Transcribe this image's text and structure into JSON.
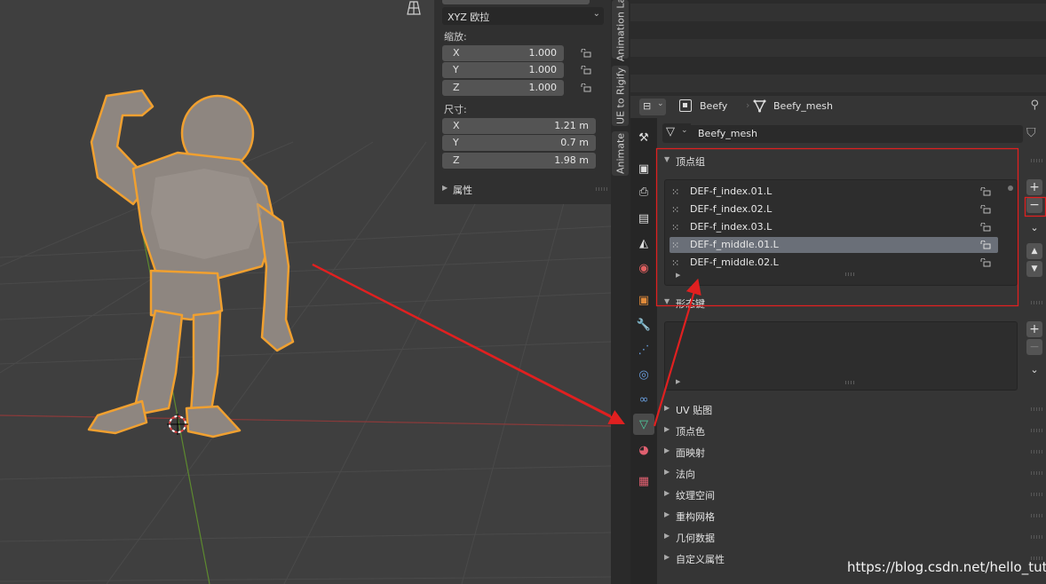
{
  "npanel": {
    "rotation_mode": "XYZ 欧拉",
    "scale_label": "缩放:",
    "scale": [
      {
        "axis": "X",
        "value": "1.000"
      },
      {
        "axis": "Y",
        "value": "1.000"
      },
      {
        "axis": "Z",
        "value": "1.000"
      }
    ],
    "dimensions_label": "尺寸:",
    "dimensions": [
      {
        "axis": "X",
        "value": "1.21 m"
      },
      {
        "axis": "Y",
        "value": "0.7 m"
      },
      {
        "axis": "Z",
        "value": "1.98 m"
      }
    ],
    "properties_label": "属性"
  },
  "vertical_tabs": [
    "Animation La",
    "UE to Rigify",
    "Animate"
  ],
  "properties": {
    "object_name": "Beefy",
    "mesh_name": "Beefy_mesh",
    "data_name": "Beefy_mesh",
    "vertex_groups_title": "顶点组",
    "vertex_groups": [
      {
        "name": "DEF-f_index.01.L",
        "selected": false
      },
      {
        "name": "DEF-f_index.02.L",
        "selected": false
      },
      {
        "name": "DEF-f_index.03.L",
        "selected": false
      },
      {
        "name": "DEF-f_middle.01.L",
        "selected": true
      },
      {
        "name": "DEF-f_middle.02.L",
        "selected": false
      }
    ],
    "shape_keys_title": "形态键",
    "collapsed_panels": [
      "UV 贴图",
      "顶点色",
      "面映射",
      "法向",
      "纹理空间",
      "重构网格",
      "几何数据",
      "自定义属性"
    ]
  },
  "watermark": "https://blog.csdn.net/hello_tute",
  "colors": {
    "accent_red": "#e02020",
    "selection_outline": "#f0a030",
    "active_tab": "#4fd0a0"
  }
}
